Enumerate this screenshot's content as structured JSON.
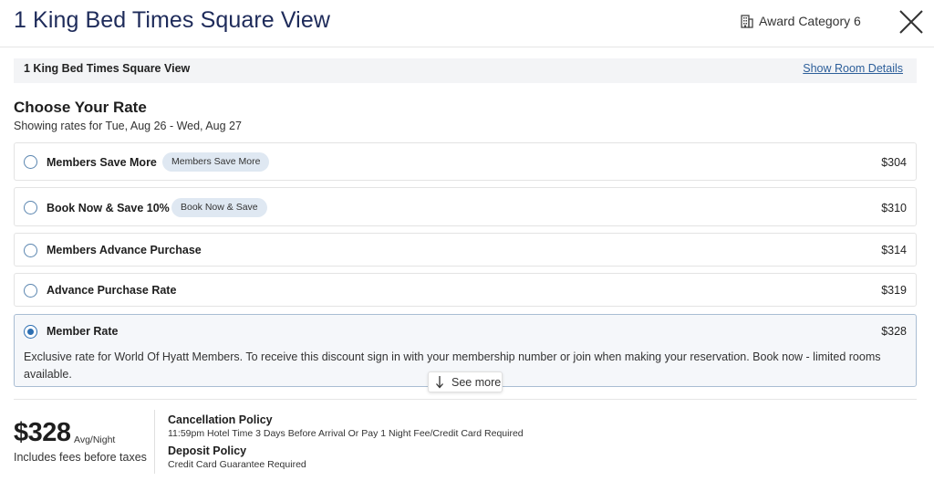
{
  "header": {
    "title": "1 King Bed Times Square View",
    "award_category": "Award Category 6",
    "award_icon": "building-icon",
    "close_icon": "close-icon"
  },
  "room_strip": {
    "name": "1 King Bed Times Square View",
    "details_link": "Show Room Details"
  },
  "rates_section": {
    "title": "Choose Your Rate",
    "subtitle": "Showing rates for Tue, Aug 26 - Wed, Aug 27"
  },
  "rates": [
    {
      "name": "Members Save More",
      "badge": "Members Save More",
      "price": "$304",
      "selected": false
    },
    {
      "name": "Book Now & Save 10%",
      "badge": "Book Now & Save",
      "price": "$310",
      "selected": false
    },
    {
      "name": "Members Advance Purchase",
      "badge": "",
      "price": "$314",
      "selected": false
    },
    {
      "name": "Advance Purchase Rate",
      "badge": "",
      "price": "$319",
      "selected": false
    },
    {
      "name": "Member Rate",
      "badge": "",
      "price": "$328",
      "selected": true,
      "description": "Exclusive rate for World Of Hyatt Members. To receive this discount sign in with your membership number or join when making your reservation. Book now - limited rooms available."
    }
  ],
  "see_more": {
    "label": "See more",
    "icon": "arrow-down-icon"
  },
  "summary": {
    "price": "$328",
    "price_unit": "Avg/Night",
    "fees_note": "Includes fees before taxes",
    "cancellation_title": "Cancellation Policy",
    "cancellation_text": "11:59pm Hotel Time 3 Days Before Arrival Or Pay 1 Night Fee/Credit Card Required",
    "deposit_title": "Deposit Policy",
    "deposit_text": "Credit Card Guarantee Required"
  },
  "colors": {
    "title_navy": "#1e2b5a",
    "link_blue": "#2d5f9a",
    "radio_selected": "#2d6fb2",
    "badge_bg": "#dfe8f2",
    "selected_bg": "#f5f7fa"
  }
}
